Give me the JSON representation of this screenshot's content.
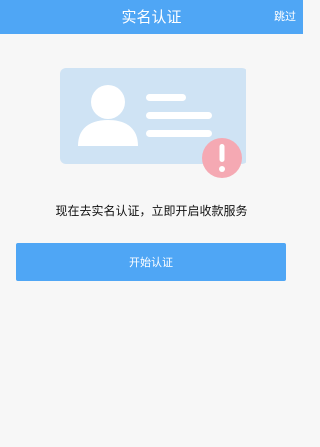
{
  "header": {
    "title": "实名认证",
    "skip_label": "跳过"
  },
  "main": {
    "illustration_icon": "id-card-warning-icon",
    "message": "现在去实名认证，立即开启收款服务",
    "start_button_label": "开始认证"
  },
  "colors": {
    "brand_blue": "#4fa6f5",
    "card_blue": "#cfe3f4",
    "warning_pink": "#f5a9b3",
    "page_background": "#f7f7f7"
  }
}
